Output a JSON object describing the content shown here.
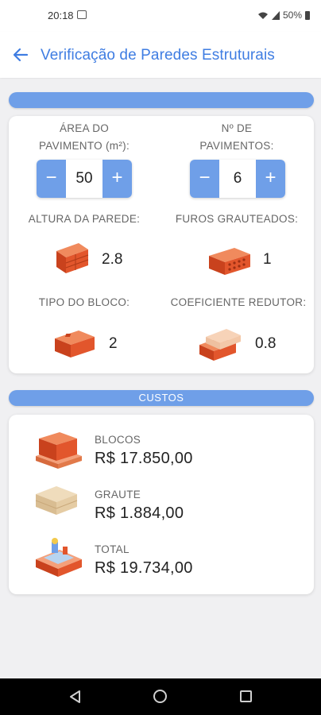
{
  "status_bar": {
    "time": "20:18",
    "battery": "50%"
  },
  "app_bar": {
    "title": "Verificação de Paredes Estruturais"
  },
  "inputs": {
    "area": {
      "label_line1": "ÁREA DO",
      "label_line2": "PAVIMENTO (m²):",
      "value": "50",
      "minus": "−",
      "plus": "+"
    },
    "floors": {
      "label_line1": "Nº DE",
      "label_line2": "PAVIMENTOS:",
      "value": "6",
      "minus": "−",
      "plus": "+"
    },
    "wall_height": {
      "label": "ALTURA DA PAREDE:",
      "value": "2.8"
    },
    "grouted_holes": {
      "label": "FUROS GRAUTEADOS:",
      "value": "1"
    },
    "block_type": {
      "label": "TIPO DO BLOCO:",
      "value": "2"
    },
    "reduction_coef": {
      "label": "COEFICIENTE REDUTOR:",
      "value": "0.8"
    }
  },
  "costs": {
    "header": "CUSTOS",
    "blocks": {
      "label": "BLOCOS",
      "value": "R$ 17.850,00"
    },
    "grout": {
      "label": "GRAUTE",
      "value": "R$ 1.884,00"
    },
    "total": {
      "label": "TOTAL",
      "value": "R$ 19.734,00"
    }
  },
  "colors": {
    "accent": "#6f9fe8",
    "title": "#3f7de2",
    "brick": "#e2562c"
  }
}
